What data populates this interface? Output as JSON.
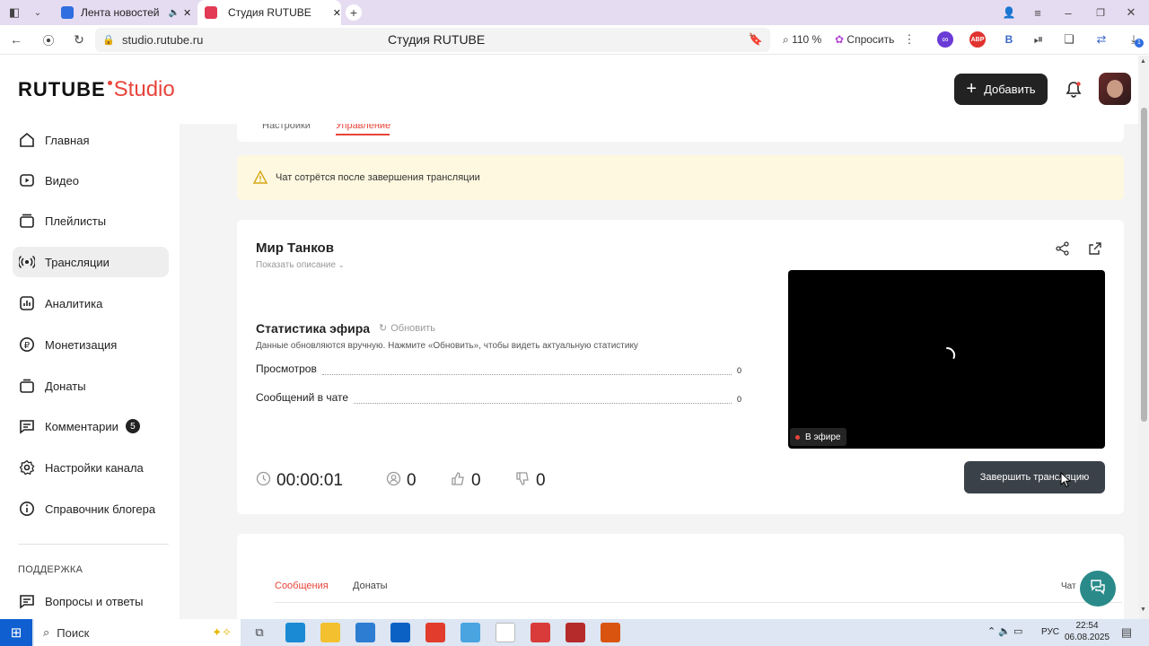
{
  "browser": {
    "tabs": [
      {
        "label": "Лента новостей"
      },
      {
        "label": "Студия RUTUBE"
      }
    ],
    "address": "studio.rutube.ru",
    "page_title": "Студия RUTUBE",
    "zoom": "110 %",
    "ask_label": "Спросить",
    "ext_abp": "ABP",
    "ext_b": "B",
    "badge_count": "1"
  },
  "header": {
    "logo_main": "RUTUBE",
    "logo_studio": "Studio",
    "add_label": "Добавить"
  },
  "sidebar": {
    "items": [
      {
        "label": "Главная"
      },
      {
        "label": "Видео"
      },
      {
        "label": "Плейлисты"
      },
      {
        "label": "Трансляции"
      },
      {
        "label": "Аналитика"
      },
      {
        "label": "Монетизация"
      },
      {
        "label": "Донаты"
      },
      {
        "label": "Комментарии",
        "badge": "5"
      },
      {
        "label": "Настройки канала"
      },
      {
        "label": "Справочник блогера"
      }
    ],
    "support_heading": "ПОДДЕРЖКА",
    "faq_label": "Вопросы и ответы"
  },
  "tabs": {
    "settings": "Настройки",
    "management": "Управление"
  },
  "warning": "Чат сотрётся после завершения трансляции",
  "stream": {
    "title": "Мир Танков",
    "show_description": "Показать описание",
    "stats_title": "Статистика эфира",
    "refresh_label": "Обновить",
    "stats_note": "Данные обновляются вручную. Нажмите «Обновить», чтобы видеть актуальную статистику",
    "stats": [
      {
        "label": "Просмотров",
        "value": "0"
      },
      {
        "label": "Сообщений в чате",
        "value": "0"
      }
    ],
    "live_label": "В эфире",
    "timer": "00:00:01",
    "viewers": "0",
    "likes": "0",
    "dislikes": "0",
    "end_button": "Завершить трансляцию"
  },
  "chat": {
    "tab_messages": "Сообщения",
    "tab_donations": "Донаты",
    "chat_label": "Чат"
  },
  "taskbar": {
    "search": "Поиск",
    "lang": "РУС",
    "time": "22:54",
    "date": "06.08.2025"
  },
  "colors": {
    "accent": "#e8443a",
    "dark": "#222222",
    "warning_bg": "#fdf8df",
    "button_dark": "#3a4148"
  }
}
